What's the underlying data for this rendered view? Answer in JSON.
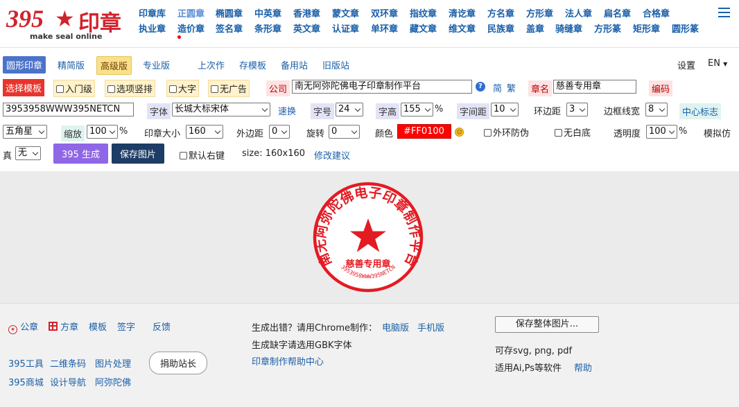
{
  "brand": {
    "number": "395",
    "star": "★",
    "name": "印章",
    "tagline": "make seal online"
  },
  "nav": {
    "row1": [
      "印章库",
      "正圆章",
      "椭圆章",
      "中英章",
      "香港章",
      "蒙文章",
      "双环章",
      "指纹章",
      "清讫章",
      "方名章",
      "方形章",
      "法人章",
      "扁名章",
      "合格章"
    ],
    "row2": [
      "执业章",
      "造价章",
      "签名章",
      "条形章",
      "英文章",
      "认证章",
      "单环章",
      "藏文章",
      "维文章",
      "民族章",
      "盖章",
      "骑缝章",
      "方形篆",
      "矩形章",
      "圆形篆"
    ],
    "menu_icon": "hamburger-icon"
  },
  "modes": {
    "items": [
      "圆形印章",
      "精简版",
      "高级版",
      "专业版"
    ],
    "links": [
      "上次作",
      "存模板",
      "备用站",
      "旧版站"
    ],
    "settings": "设置",
    "lang": "EN"
  },
  "row1": {
    "template_btn": "选择模板",
    "checks": [
      "入门级",
      "选项竖排",
      "大字",
      "无广告"
    ],
    "company_label": "公司",
    "company_value": "南无阿弥陀佛电子印章制作平台",
    "help_icon": "question-icon",
    "simp": "简",
    "trad": "繁",
    "seal_name_label": "章名",
    "seal_name_value": "慈善专用章",
    "code_btn": "编码"
  },
  "row2": {
    "code_value": "3953958WWW395NETCN",
    "font_label": "字体",
    "font_value": "长城大标宋体",
    "quick_switch": "速换",
    "size_label": "字号",
    "size_value": "24",
    "height_label": "字高",
    "height_value": "155",
    "height_unit": "%",
    "spacing_label": "字间距",
    "spacing_value": "10",
    "ring_label": "环边距",
    "ring_value": "3",
    "border_label": "边框线宽",
    "border_value": "8",
    "center_label": "中心标志"
  },
  "row3": {
    "shape_value": "五角星",
    "scale_label": "缩放",
    "scale_value": "100",
    "scale_unit": "%",
    "seal_size_label": "印章大小",
    "seal_size_value": "160",
    "outer_label": "外边距",
    "outer_value": "0",
    "rotate_label": "旋转",
    "rotate_value": "0",
    "color_label": "颜色",
    "color_value": "#FF0100",
    "outer_ring_label": "外环防伪",
    "no_white_label": "无白底",
    "opacity_label": "透明度",
    "opacity_value": "100",
    "opacity_unit": "%",
    "simulate_label": "模拟仿"
  },
  "row4": {
    "true_label": "真",
    "true_value": "无",
    "generate_btn": "395 生成",
    "save_btn": "保存图片",
    "right_click_label": "默认右键",
    "size_text": "size: 160x160",
    "suggest_link": "修改建议"
  },
  "seal": {
    "company": "南无阿弥陀佛电子印章制作平台",
    "name": "慈善专用章",
    "code": "3953958WWW395NETCN",
    "color": "#e31b23"
  },
  "footer": {
    "col1_row1": [
      "公章",
      "方章",
      "模板",
      "签字",
      "反馈"
    ],
    "col1_row2": [
      "395工具",
      "二维条码",
      "图片处理"
    ],
    "donate_btn": "捐助站长",
    "col1_row3": [
      "395商城",
      "设计导航",
      "阿弥陀佛"
    ],
    "col2_line1_prefix": "生成出错？请用Chrome制作：",
    "col2_line1_links": [
      "电脑版",
      "手机版"
    ],
    "col2_line2": "生成缺字请选用GBK字体",
    "col2_line3": "印章制作帮助中心",
    "save_all_btn": "保存整体图片...",
    "col3_line1": "可存svg, png, pdf",
    "col3_line2": "适用Ai,Ps等软件",
    "col3_help": "帮助"
  }
}
